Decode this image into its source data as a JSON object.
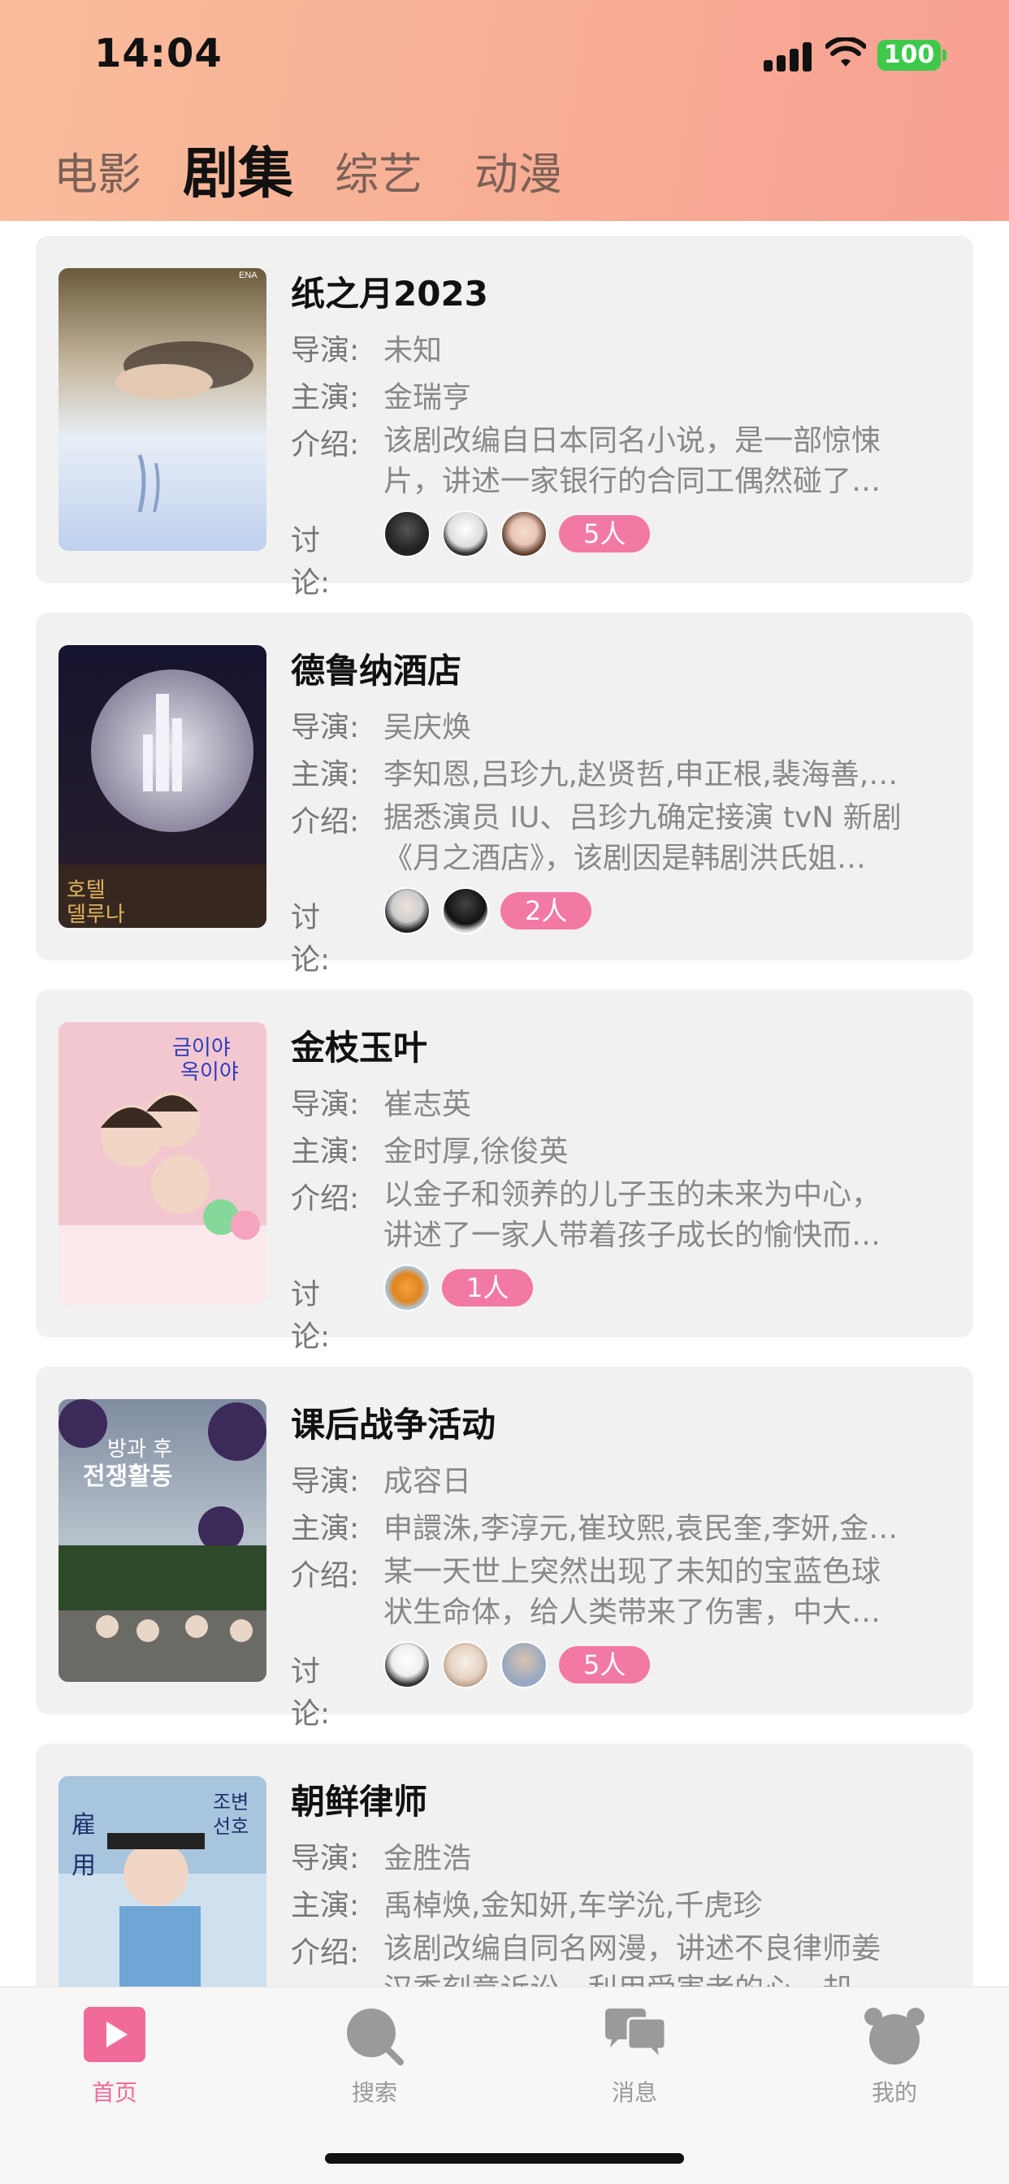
{
  "status_bar": {
    "time": "14:04",
    "battery": "100"
  },
  "tabs": [
    {
      "label": "电影",
      "active": false
    },
    {
      "label": "剧集",
      "active": true
    },
    {
      "label": "综艺",
      "active": false
    },
    {
      "label": "动漫",
      "active": false
    }
  ],
  "field_labels": {
    "director": "导演:",
    "cast": "主演:",
    "intro": "介绍:",
    "discussion": "讨论:"
  },
  "shows": [
    {
      "title": "纸之月2023",
      "director": "未知",
      "cast": "金瑞亨",
      "intro_line1": "该剧改编自日本同名小说，是一部惊悚",
      "intro_line2": "片，讲述一家银行的合同工偶然碰了…",
      "participants": "5人",
      "poster_theme": "sleeping-woman-poster"
    },
    {
      "title": "德鲁纳酒店",
      "director": "吴庆焕",
      "cast": "李知恩,吕珍九,赵贤哲,申正根,裴海善,…",
      "intro_line1": "据悉演员 IU、吕珍九确定接演 tvN 新剧",
      "intro_line2": "《月之酒店》，该剧因是韩剧洪氏姐…",
      "participants": "2人",
      "poster_theme": "moon-hotel-poster"
    },
    {
      "title": "金枝玉叶",
      "director": "崔志英",
      "cast": "金时厚,徐俊英",
      "intro_line1": "以金子和领养的儿子玉的未来为中心，",
      "intro_line2": "讲述了一家人带着孩子成长的愉快而…",
      "participants": "1人",
      "poster_theme": "family-cartoon-poster"
    },
    {
      "title": "课后战争活动",
      "director": "成容日",
      "cast": "申譞洙,李淳元,崔玟熙,袁民奎,李妍,金…",
      "intro_line1": "某一天世上突然出现了未知的宝蓝色球",
      "intro_line2": "状生命体，给人类带来了伤害，中大…",
      "participants": "5人",
      "poster_theme": "war-activity-poster"
    },
    {
      "title": "朝鲜律师",
      "director": "金胜浩",
      "cast": "禹棹焕,金知妍,车学沇,千虎珍",
      "intro_line1": "该剧改编自同名网漫，讲述不良律师姜",
      "intro_line2": "汉秀刻意诉讼，利用受害者的心，却…",
      "participants": "",
      "poster_theme": "joseon-lawyer-poster"
    }
  ],
  "bottom_nav": [
    {
      "label": "首页",
      "icon": "play-icon",
      "active": true
    },
    {
      "label": "搜索",
      "icon": "search-icon",
      "active": false
    },
    {
      "label": "消息",
      "icon": "chat-icon",
      "active": false
    },
    {
      "label": "我的",
      "icon": "bear-icon",
      "active": false
    }
  ],
  "colors": {
    "header_gradient_start": "#f9bd9c",
    "header_gradient_end": "#f7a093",
    "accent_pink": "#f279a4",
    "nav_active": "#f06b9a"
  }
}
